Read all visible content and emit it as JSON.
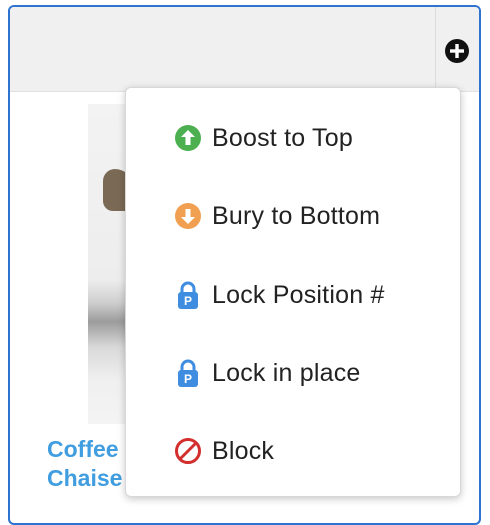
{
  "card": {
    "title": "Coffee\nChaise"
  },
  "header": {
    "add_icon": "plus-circle-icon"
  },
  "menu": {
    "items": [
      {
        "label": "Boost to Top",
        "icon": "arrow-up-circle-icon",
        "color": "#4caf50"
      },
      {
        "label": "Bury to Bottom",
        "icon": "arrow-down-circle-icon",
        "color": "#f0a050"
      },
      {
        "label": "Lock Position #",
        "icon": "lock-p-icon",
        "color": "#3f8de0"
      },
      {
        "label": "Lock in place",
        "icon": "lock-p-icon",
        "color": "#3f8de0"
      },
      {
        "label": "Block",
        "icon": "block-icon",
        "color": "#d32f2f"
      }
    ]
  }
}
